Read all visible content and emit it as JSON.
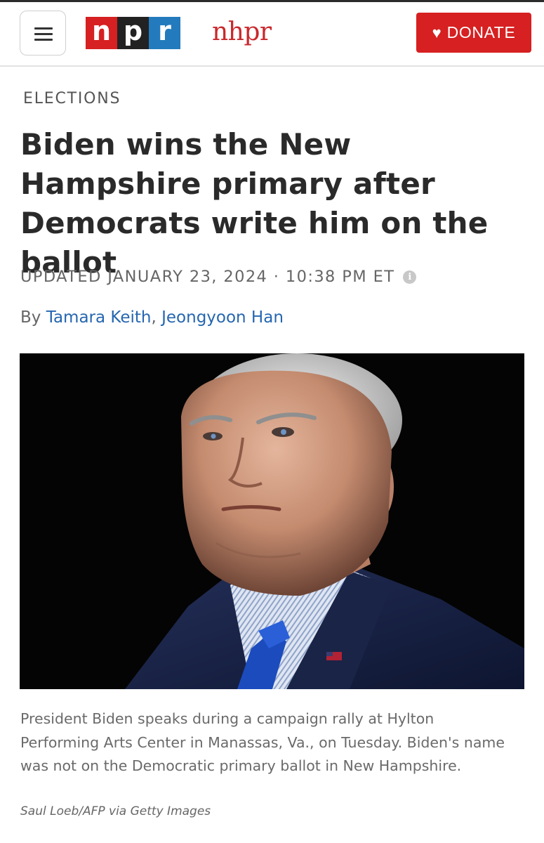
{
  "header": {
    "menu_icon": "hamburger-menu-icon",
    "logo": {
      "letters": [
        "n",
        "p",
        "r"
      ],
      "colors": [
        "#d62021",
        "#222222",
        "#237bbd"
      ]
    },
    "station": "nhpr",
    "donate": {
      "label": "DONATE",
      "icon": "heart-icon",
      "color": "#d62021"
    }
  },
  "article": {
    "section": "ELECTIONS",
    "headline": "Biden wins the New Hampshire primary after Democrats write him on the ballot",
    "dateline": "UPDATED JANUARY 23, 2024 · 10:38 PM ET",
    "info_icon": "info-icon",
    "byline_prefix": "By",
    "authors": [
      "Tamara Keith",
      "Jeongyoon Han"
    ],
    "author_separator": ", ",
    "link_color": "#2566b0",
    "caption": "President Biden speaks during a campaign rally at Hylton Performing Arts Center in Manassas, Va., on Tuesday. Biden's name was not on the Democratic primary ballot in New Hampshire.",
    "credit": "Saul Loeb/AFP via Getty Images"
  }
}
